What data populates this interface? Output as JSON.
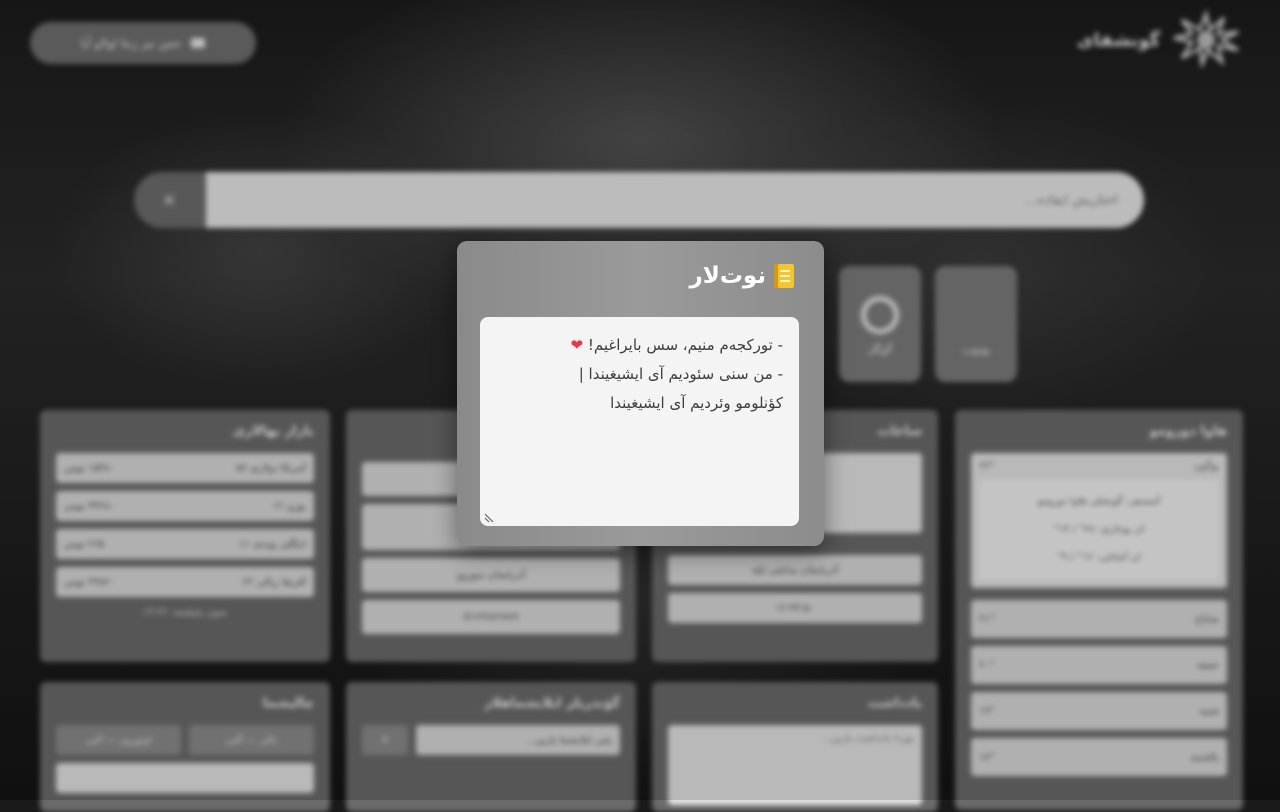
{
  "header": {
    "brand": "گونشفای",
    "pill_button_label": "حس نیز زنتا لولاو آیا",
    "logo_icon": "sun-logo-icon"
  },
  "search": {
    "placeholder": "آختاریش ایفاده...",
    "clear_icon": "close-icon"
  },
  "shortcuts": [
    {
      "label": "یوتوب"
    },
    {
      "label": "گوگل",
      "icon": "google-circle-icon"
    }
  ],
  "widgets": {
    "currency": {
      "title": "بازار بهالاری",
      "rows": [
        {
          "name": "آمریکا دولاری ۵۶",
          "value": "۱۵۴۸۰ تومن"
        },
        {
          "name": "یورو ۲۱",
          "value": "۴۴۲۸۰ تومن"
        },
        {
          "name": "اینگلیز پوندی ۱۱",
          "value": "۲۶۵ تومن"
        },
        {
          "name": "آفریقا ریالی ۲۲",
          "value": "۳۹۸۲۰ تومن"
        }
      ],
      "footer": "سون یئنیلنمه: ۱۴:۳۶"
    },
    "middle": {
      "rows": [
        "",
        "",
        "آذربایجان سوزوو",
        "0١٢٣٤٥٦٧٨٩"
      ]
    },
    "clock": {
      "title": "ساعات",
      "rows": [
        "آذربایجان ساعتی ایله",
        "۱۲:۳۴:۵۰"
      ]
    },
    "weather": {
      "title": "هاوا دورومو",
      "today": {
        "label": "بوگون",
        "temp": "۲۳°"
      },
      "details": [
        "آتمسفر: گونشلی هاوا دورومو",
        "ان یوخاری: ۲۸° / ۱۴°",
        "ان آشاغی: ۱۲° / ۹°"
      ],
      "days": [
        {
          "label": "صاباح",
          "temp": "۲۱°"
        },
        {
          "label": "جمعه",
          "temp": "۲۰°"
        },
        {
          "label": "شنبه",
          "temp": "۱۹°"
        },
        {
          "label": "یکشنبه",
          "temp": "۱۸°"
        }
      ]
    },
    "bottom_left": {
      "title": "چالیشما",
      "buttons": [
        "دالی — آلتی",
        "اوتورون — آلتی"
      ]
    },
    "bottom_mid": {
      "title": "گؤندریلر ایلایشماهلار",
      "input_placeholder": "یئنی ایلایشما یازین..."
    },
    "bottom_right": {
      "title": "یادداشت",
      "placeholder": "بوردا یادداشت یازین..."
    }
  },
  "notes_modal": {
    "title": "نوت‌لار",
    "icon": "notebook-icon",
    "lines": [
      "- تورکجه‌م منیم، سس بایراغیم! ",
      "- من سنی سئودیم آی ایشیغیندا |",
      "کؤنلومو وئردیم آی ایشیغیندا"
    ],
    "heart_icon": "heart-icon"
  }
}
